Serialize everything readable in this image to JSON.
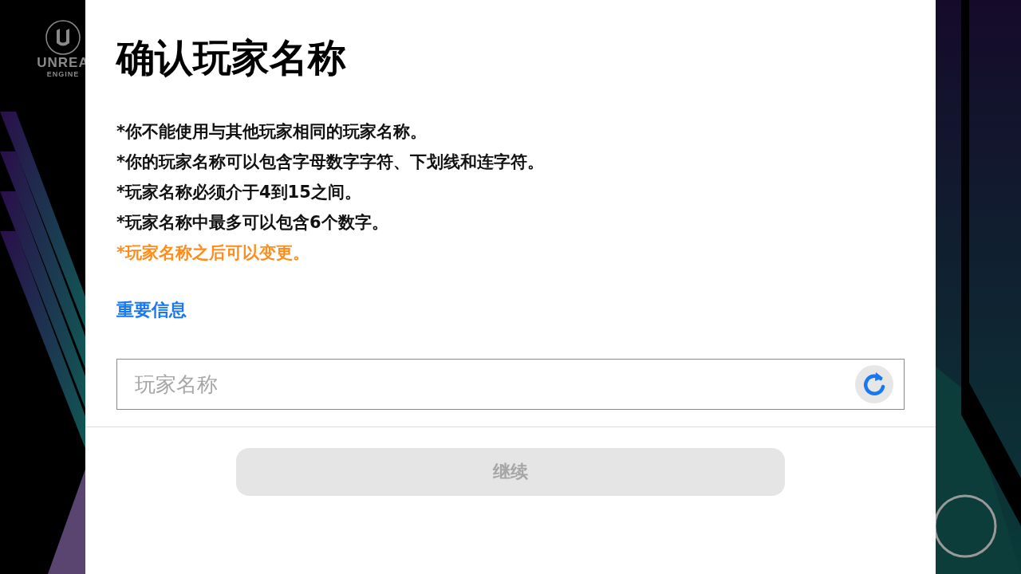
{
  "logo": {
    "line_1": "UNREA",
    "line_2": "ENGINE"
  },
  "dialog": {
    "title": "确认玩家名称",
    "rules": [
      {
        "text": "*你不能使用与其他玩家相同的玩家名称。",
        "highlighted": false
      },
      {
        "text": "*你的玩家名称可以包含字母数字字符、下划线和连字符。",
        "highlighted": false
      },
      {
        "text": "*玩家名称必须介于4到15之间。",
        "highlighted": false
      },
      {
        "text": "*玩家名称中最多可以包含6个数字。",
        "highlighted": false
      },
      {
        "text": "*玩家名称之后可以变更。",
        "highlighted": true
      }
    ],
    "link": "重要信息",
    "name_field": {
      "placeholder": "玩家名称"
    },
    "continue_button": {
      "label": "继续",
      "disabled": true
    }
  }
}
